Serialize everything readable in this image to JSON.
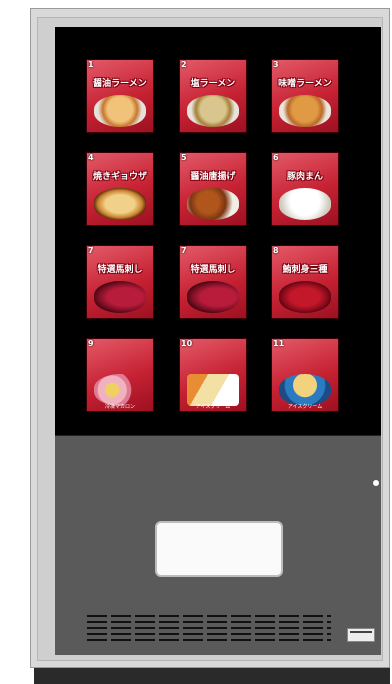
{
  "tiles": [
    {
      "num": "1",
      "name": "醤油ラーメン",
      "food": "shoyu-ramen",
      "cls": "plate"
    },
    {
      "num": "2",
      "name": "塩ラーメン",
      "food": "shio-ramen",
      "cls": "soup2"
    },
    {
      "num": "3",
      "name": "味噌ラーメン",
      "food": "miso-ramen",
      "cls": "soup3"
    },
    {
      "num": "4",
      "name": "焼きギョウザ",
      "food": "gyoza",
      "cls": "gyoza"
    },
    {
      "num": "5",
      "name": "醤油唐揚げ",
      "food": "karaage",
      "cls": "karaage"
    },
    {
      "num": "6",
      "name": "豚肉まん",
      "food": "nikuman",
      "cls": "nikuman"
    },
    {
      "num": "7",
      "name": "特選馬刺し",
      "food": "basashi",
      "cls": "basashi"
    },
    {
      "num": "7",
      "name": "特選馬刺し",
      "food": "basashi",
      "cls": "basashi"
    },
    {
      "num": "8",
      "name": "鮪刺身三種",
      "food": "sashimi",
      "cls": "sashimi"
    },
    {
      "num": "9",
      "name": "",
      "label": "冷凍マカロン",
      "food": "macaron",
      "cls": "macaron"
    },
    {
      "num": "10",
      "name": "",
      "label": "アイスクリーム",
      "food": "icecream",
      "cls": "icecream1"
    },
    {
      "num": "11",
      "name": "",
      "label": "アイスクリーム",
      "food": "icecream",
      "cls": "icecream2"
    }
  ],
  "colors": {
    "tile": "#c62233",
    "screen": "#000000",
    "lower_panel": "#5a5a5a"
  }
}
